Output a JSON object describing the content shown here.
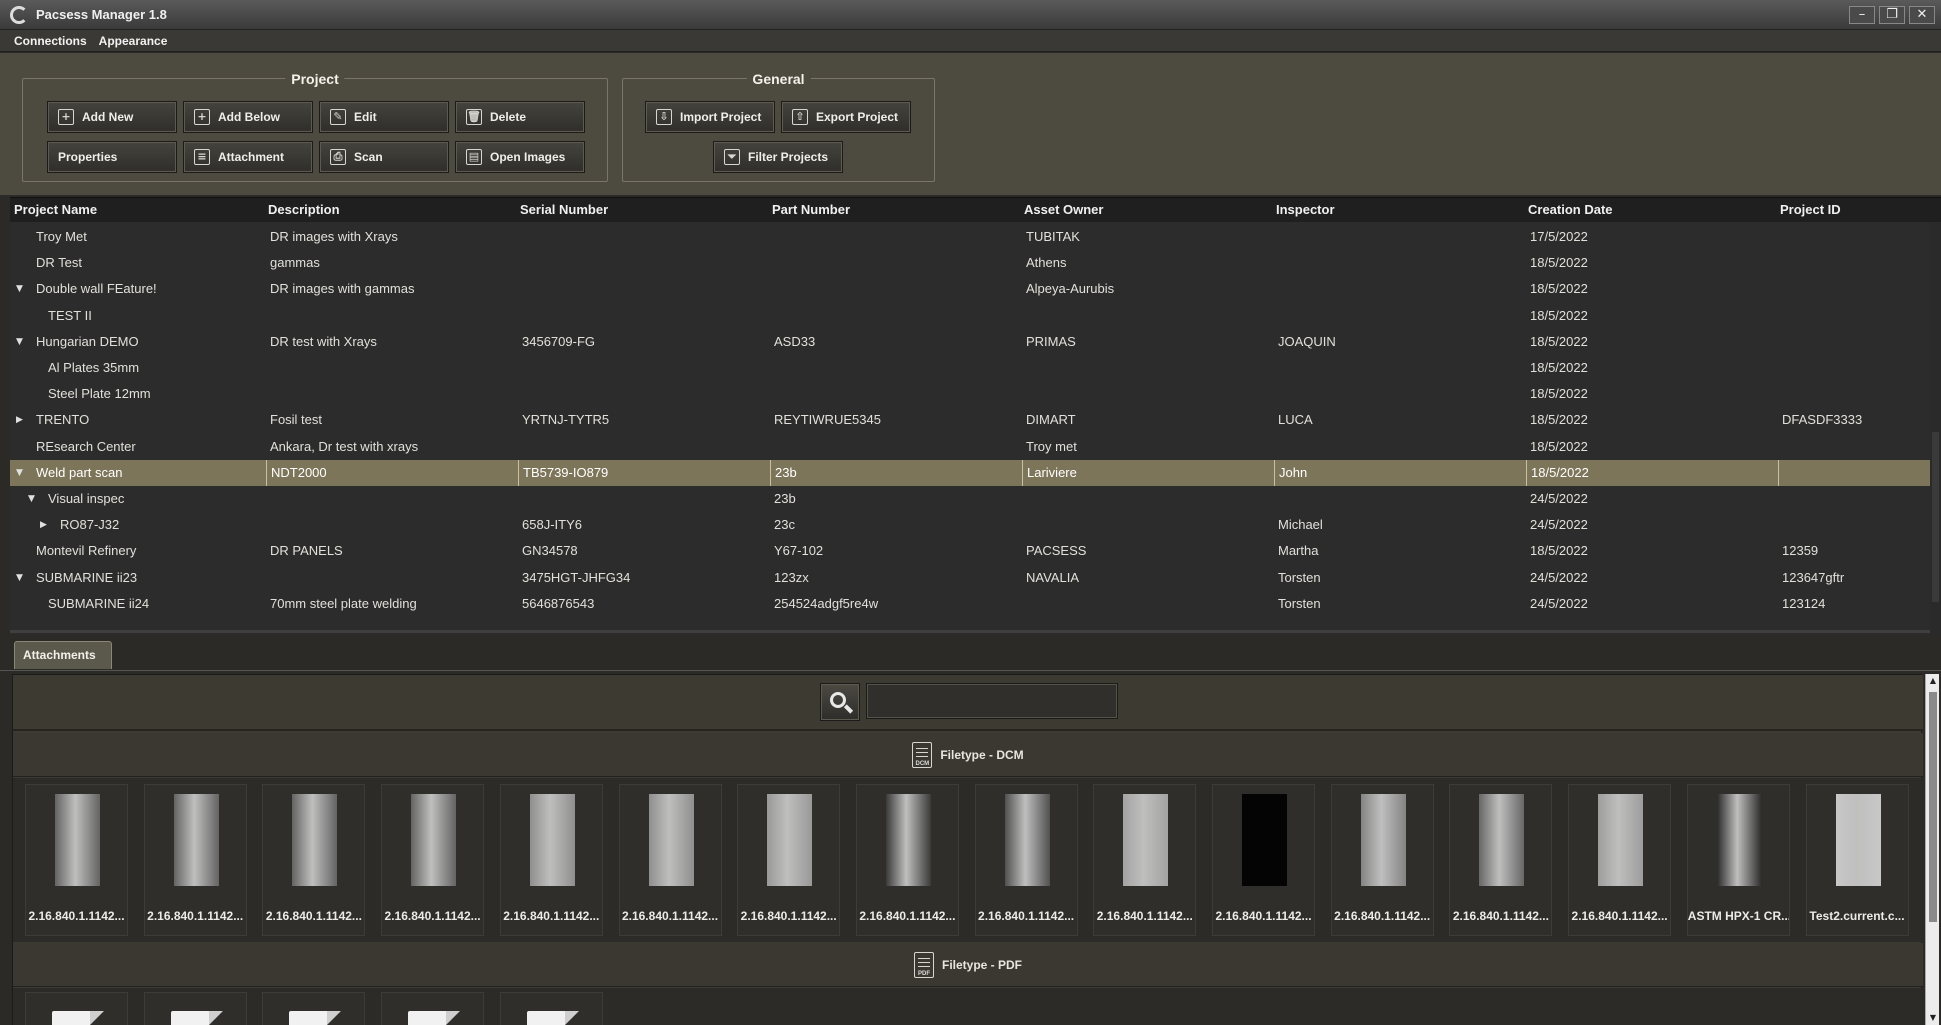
{
  "window": {
    "title": "Pacsess Manager 1.8",
    "controls": {
      "minimize": "–",
      "maximize": "❐",
      "close": "✕"
    }
  },
  "menu": [
    "Connections",
    "Appearance"
  ],
  "toolbar": {
    "project_group_title": "Project",
    "general_group_title": "General",
    "project_buttons": [
      {
        "label": "Add New",
        "icon": "add-icon",
        "glyph": "+"
      },
      {
        "label": "Add Below",
        "icon": "add-below-icon",
        "glyph": "+"
      },
      {
        "label": "Edit",
        "icon": "edit-icon",
        "glyph": "✎"
      },
      {
        "label": "Delete",
        "icon": "trash-icon",
        "glyph": "🗑"
      },
      {
        "label": "Properties",
        "icon": "",
        "glyph": ""
      },
      {
        "label": "Attachment",
        "icon": "attachment-icon",
        "glyph": "≡"
      },
      {
        "label": "Scan",
        "icon": "scanner-icon",
        "glyph": "⎙"
      },
      {
        "label": "Open Images",
        "icon": "open-images-icon",
        "glyph": "▤"
      }
    ],
    "general_buttons": [
      {
        "label": "Import Project",
        "icon": "import-icon",
        "glyph": "⇩"
      },
      {
        "label": "Export Project",
        "icon": "export-icon",
        "glyph": "⇧"
      },
      {
        "label": "Filter Projects",
        "icon": "filter-icon",
        "glyph": "⏷"
      }
    ]
  },
  "table": {
    "columns": [
      "Project Name",
      "Description",
      "Serial Number",
      "Part Number",
      "Asset Owner",
      "Inspector",
      "Creation Date",
      "Project ID"
    ],
    "rows": [
      {
        "level": 0,
        "expander": "",
        "name": "Troy Met",
        "description": "DR images with Xrays",
        "serial": "",
        "part": "",
        "owner": "TUBITAK",
        "inspector": "",
        "date": "17/5/2022",
        "id": "",
        "selected": false
      },
      {
        "level": 0,
        "expander": "",
        "name": "DR Test",
        "description": "gammas",
        "serial": "",
        "part": "",
        "owner": "Athens",
        "inspector": "",
        "date": "18/5/2022",
        "id": "",
        "selected": false
      },
      {
        "level": 0,
        "expander": "▼",
        "name": "Double wall FEature!",
        "description": "DR images with gammas",
        "serial": "",
        "part": "",
        "owner": "Alpeya-Aurubis",
        "inspector": "",
        "date": "18/5/2022",
        "id": "",
        "selected": false
      },
      {
        "level": 1,
        "expander": "",
        "name": "TEST II",
        "description": "",
        "serial": "",
        "part": "",
        "owner": "",
        "inspector": "",
        "date": "18/5/2022",
        "id": "",
        "selected": false
      },
      {
        "level": 0,
        "expander": "▼",
        "name": "Hungarian DEMO",
        "description": "DR test with Xrays",
        "serial": "3456709-FG",
        "part": "ASD33",
        "owner": "PRIMAS",
        "inspector": "JOAQUIN",
        "date": "18/5/2022",
        "id": "",
        "selected": false
      },
      {
        "level": 1,
        "expander": "",
        "name": "Al Plates 35mm",
        "description": "",
        "serial": "",
        "part": "",
        "owner": "",
        "inspector": "",
        "date": "18/5/2022",
        "id": "",
        "selected": false
      },
      {
        "level": 1,
        "expander": "",
        "name": "Steel Plate 12mm",
        "description": "",
        "serial": "",
        "part": "",
        "owner": "",
        "inspector": "",
        "date": "18/5/2022",
        "id": "",
        "selected": false
      },
      {
        "level": 0,
        "expander": "▶",
        "name": "TRENTO",
        "description": "Fosil test",
        "serial": "YRTNJ-TYTR5",
        "part": "REYTIWRUE5345",
        "owner": "DIMART",
        "inspector": "LUCA",
        "date": "18/5/2022",
        "id": "DFASDF3333",
        "selected": false
      },
      {
        "level": 0,
        "expander": "",
        "name": "REsearch Center",
        "description": "Ankara, Dr test with xrays",
        "serial": "",
        "part": "",
        "owner": "Troy met",
        "inspector": "",
        "date": "18/5/2022",
        "id": "",
        "selected": false
      },
      {
        "level": 0,
        "expander": "▼",
        "name": "Weld part scan",
        "description": "NDT2000",
        "serial": "TB5739-IO879",
        "part": "23b",
        "owner": "Lariviere",
        "inspector": "John",
        "date": "18/5/2022",
        "id": "",
        "selected": true
      },
      {
        "level": 1,
        "expander": "▼",
        "name": "Visual inspec",
        "description": "",
        "serial": "",
        "part": "23b",
        "owner": "",
        "inspector": "",
        "date": "24/5/2022",
        "id": "",
        "selected": false
      },
      {
        "level": 2,
        "expander": "▶",
        "name": "RO87-J32",
        "description": "",
        "serial": "658J-ITY6",
        "part": "23c",
        "owner": "",
        "inspector": "Michael",
        "date": "24/5/2022",
        "id": "",
        "selected": false
      },
      {
        "level": 0,
        "expander": "",
        "name": "Montevil Refinery",
        "description": "DR PANELS",
        "serial": "GN34578",
        "part": "Y67-102",
        "owner": "PACSESS",
        "inspector": "Martha",
        "date": "18/5/2022",
        "id": "12359",
        "selected": false
      },
      {
        "level": 0,
        "expander": "▼",
        "name": "SUBMARINE ii23",
        "description": "",
        "serial": "3475HGT-JHFG34",
        "part": "123zx",
        "owner": "NAVALIA",
        "inspector": "Torsten",
        "date": "24/5/2022",
        "id": "123647gftr",
        "selected": false
      },
      {
        "level": 1,
        "expander": "",
        "name": "SUBMARINE ii24",
        "description": "70mm steel plate welding",
        "serial": "5646876543",
        "part": "254524adgf5re4w",
        "owner": "",
        "inspector": "Torsten",
        "date": "24/5/2022",
        "id": "123124",
        "selected": false
      }
    ]
  },
  "attachments": {
    "tab_label": "Attachments",
    "search_value": "",
    "dcm_header": "Filetype - DCM",
    "dcm_icon_text": "DCM",
    "pdf_header": "Filetype - PDF",
    "pdf_icon_text": "PDF",
    "dcm_items": [
      {
        "label": "2.16.840.1.1142...",
        "tone": "#6a6a6a"
      },
      {
        "label": "2.16.840.1.1142...",
        "tone": "#6a6a6a"
      },
      {
        "label": "2.16.840.1.1142...",
        "tone": "#6a6a6a"
      },
      {
        "label": "2.16.840.1.1142...",
        "tone": "#6a6a6a"
      },
      {
        "label": "2.16.840.1.1142...",
        "tone": "#9a9a9a"
      },
      {
        "label": "2.16.840.1.1142...",
        "tone": "#9a9a9a"
      },
      {
        "label": "2.16.840.1.1142...",
        "tone": "#a5a5a5"
      },
      {
        "label": "2.16.840.1.1142...",
        "tone": "#3c3c3c"
      },
      {
        "label": "2.16.840.1.1142...",
        "tone": "#555555"
      },
      {
        "label": "2.16.840.1.1142...",
        "tone": "#b0b0b0"
      },
      {
        "label": "2.16.840.1.1142...",
        "tone": "#000000"
      },
      {
        "label": "2.16.840.1.1142...",
        "tone": "#8e8e8e"
      },
      {
        "label": "2.16.840.1.1142...",
        "tone": "#6e6e6e"
      },
      {
        "label": "2.16.840.1.1142...",
        "tone": "#aaaaaa"
      },
      {
        "label": "ASTM HPX-1 CR...",
        "tone": "#2a2a2a"
      },
      {
        "label": "Test2.current.c...",
        "tone": "#d9d9d9"
      }
    ],
    "pdf_items": [
      {
        "label": ""
      },
      {
        "label": ""
      },
      {
        "label": ""
      },
      {
        "label": ""
      },
      {
        "label": ""
      }
    ]
  },
  "colors": {
    "toolbar_bg": "#4d4a40",
    "selected_row": "#7d7559",
    "table_bg": "#2c2c2c",
    "header_bg": "#1f1f1f"
  }
}
